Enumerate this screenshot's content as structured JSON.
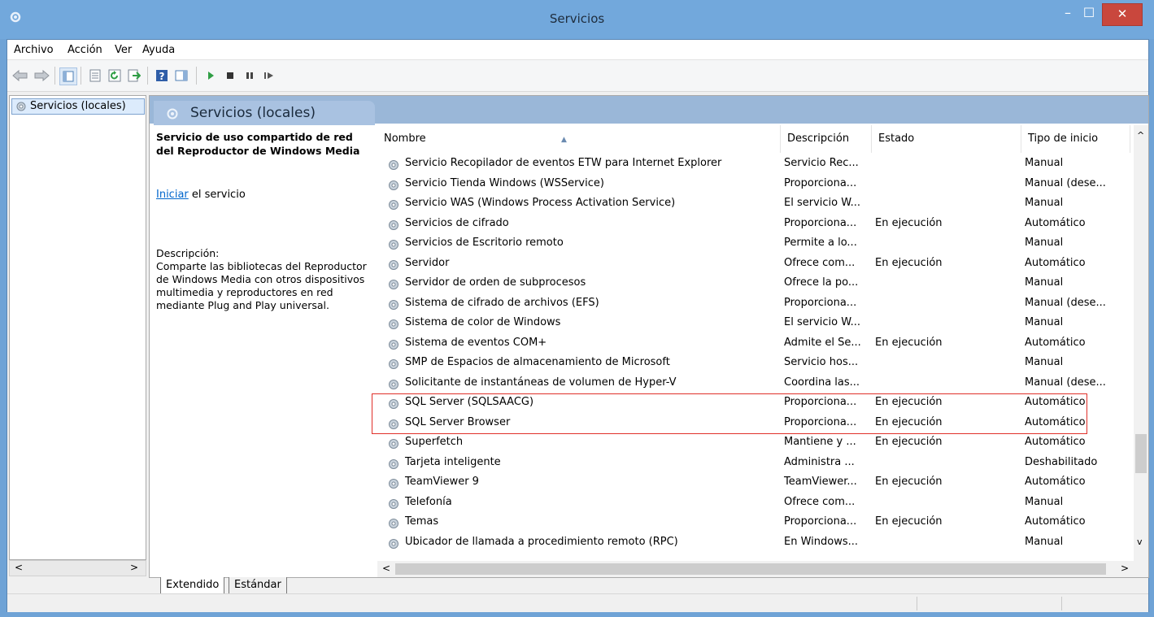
{
  "window": {
    "title": "Servicios",
    "minimize_glyph": "–",
    "maximize_glyph": "☐",
    "close_glyph": "✕"
  },
  "menu": [
    "Archivo",
    "Acción",
    "Ver",
    "Ayuda"
  ],
  "toolbar_icons": [
    "back-icon",
    "forward-icon",
    "show-hide-tree-icon",
    "properties-icon",
    "refresh-icon",
    "export-list-icon",
    "help-icon",
    "show-hide-action-pane-icon",
    "start-service-icon",
    "stop-service-icon",
    "pause-service-icon",
    "resume-service-icon"
  ],
  "tree": {
    "selected_item": "Servicios (locales)"
  },
  "content": {
    "header_title": "Servicios (locales)",
    "desc_title": "Servicio de uso compartido de red del Reproductor de Windows Media",
    "action_link": "Iniciar",
    "action_rest": " el servicio",
    "desc_label": "Descripción:",
    "desc_body": "Comparte las bibliotecas del Reproductor de Windows Media con otros dispositivos multimedia  y reproductores en red mediante Plug and Play universal."
  },
  "columns": {
    "name": "Nombre",
    "description": "Descripción",
    "state": "Estado",
    "startup": "Tipo de inicio"
  },
  "rows": [
    {
      "name": "Servicio Recopilador de eventos ETW para Internet Explorer",
      "description": "Servicio Rec...",
      "state": "",
      "startup": "Manual"
    },
    {
      "name": "Servicio Tienda Windows (WSService)",
      "description": "Proporciona...",
      "state": "",
      "startup": "Manual (dese..."
    },
    {
      "name": "Servicio WAS (Windows Process Activation Service)",
      "description": "El servicio W...",
      "state": "",
      "startup": "Manual"
    },
    {
      "name": "Servicios de cifrado",
      "description": "Proporciona...",
      "state": "En ejecución",
      "startup": "Automático"
    },
    {
      "name": "Servicios de Escritorio remoto",
      "description": "Permite a lo...",
      "state": "",
      "startup": "Manual"
    },
    {
      "name": "Servidor",
      "description": "Ofrece com...",
      "state": "En ejecución",
      "startup": "Automático"
    },
    {
      "name": "Servidor de orden de subprocesos",
      "description": "Ofrece la po...",
      "state": "",
      "startup": "Manual"
    },
    {
      "name": "Sistema de cifrado de archivos (EFS)",
      "description": "Proporciona...",
      "state": "",
      "startup": "Manual (dese..."
    },
    {
      "name": "Sistema de color de Windows",
      "description": "El servicio W...",
      "state": "",
      "startup": "Manual"
    },
    {
      "name": "Sistema de eventos COM+",
      "description": "Admite el Se...",
      "state": "En ejecución",
      "startup": "Automático"
    },
    {
      "name": "SMP de Espacios de almacenamiento de Microsoft",
      "description": "Servicio hos...",
      "state": "",
      "startup": "Manual"
    },
    {
      "name": "Solicitante de instantáneas de volumen de Hyper-V",
      "description": "Coordina las...",
      "state": "",
      "startup": "Manual (dese..."
    },
    {
      "name": "SQL Server (SQLSAACG)",
      "description": "Proporciona...",
      "state": "En ejecución",
      "startup": "Automático"
    },
    {
      "name": "SQL Server Browser",
      "description": "Proporciona...",
      "state": "En ejecución",
      "startup": "Automático"
    },
    {
      "name": "Superfetch",
      "description": "Mantiene y ...",
      "state": "En ejecución",
      "startup": "Automático"
    },
    {
      "name": "Tarjeta inteligente",
      "description": "Administra ...",
      "state": "",
      "startup": "Deshabilitado"
    },
    {
      "name": "TeamViewer 9",
      "description": "TeamViewer...",
      "state": "En ejecución",
      "startup": "Automático"
    },
    {
      "name": "Telefonía",
      "description": "Ofrece com...",
      "state": "",
      "startup": "Manual"
    },
    {
      "name": "Temas",
      "description": "Proporciona...",
      "state": "En ejecución",
      "startup": "Automático"
    },
    {
      "name": "Ubicador de llamada a procedimiento remoto (RPC)",
      "description": "En Windows...",
      "state": "",
      "startup": "Manual"
    }
  ],
  "tabs": [
    "Extendido",
    "Estándar"
  ],
  "scroll_glyphs": {
    "left": "<",
    "right": ">",
    "up": "^",
    "down": "v"
  },
  "colors": {
    "title_bar": "#72a8dc",
    "close_button": "#c9473d",
    "highlight_box": "#e0302a",
    "link": "#0066cc"
  }
}
